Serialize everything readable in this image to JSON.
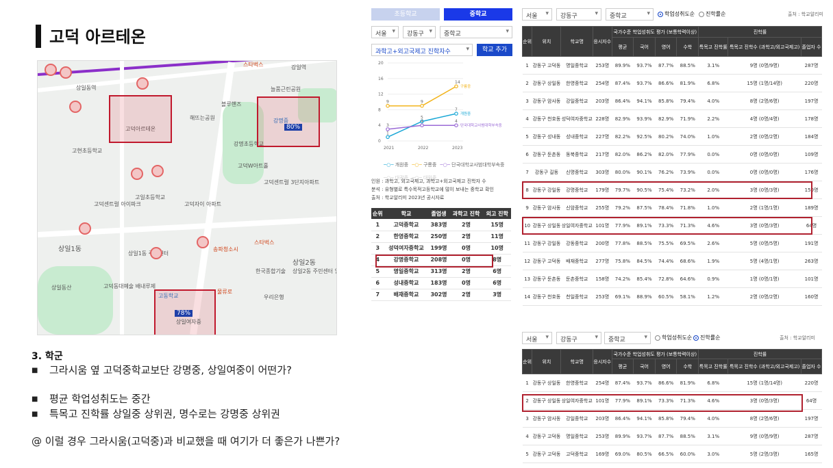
{
  "title": "고덕 아르테온",
  "map": {
    "labels": {
      "station1": "상일동역",
      "station2": "강일역",
      "starbucks1": "스타벅스",
      "park1": "늘품근린공원",
      "bluehands": "블루핸즈",
      "park2": "해뜨는공원",
      "gd_arteon": "고덕아르테온",
      "gangmyung_ms": "강명중",
      "gangmyung_es": "강명초등학교",
      "gangdong_ms": "강명초등학교",
      "wt": "고덕W아트홀",
      "gdref": "고덕센트럴\n3단지아파트",
      "gdschool1": "고현초등학교",
      "gdschool2": "고일초등학교",
      "gdcent": "고덕센트럴\n아이파크",
      "gdzai": "고덕자이\n아파트",
      "sangil1": "상일1동",
      "sangil1_center": "상일1동\n주민센터",
      "songpa": "송파청소시",
      "starbucks2": "스타벅스",
      "sangil2": "상일2동",
      "sangil2_center": "상일2동\n주민센터\n임시청사",
      "hankook": "한국종합기술",
      "gdcity": "고덕동대예술\n배내루제",
      "sangilsan": "상일동산",
      "gdhigh": "고동학교",
      "sangil_girls": "상일여자중",
      "woori": "우리은행",
      "nanum": "물류로",
      "pct_80": "80%",
      "pct_78": "78%"
    }
  },
  "section": {
    "heading": "3. 학군",
    "bullets": [
      "그라시움 옆 고덕중학교보단 강명중, 상일여중이 어떤가?",
      "평균 학업성취도는 중간",
      "특목고 진학률 상일중 상위권, 명수로는 강명중 상위권"
    ],
    "question": "@ 이럴 경우 그라시움(고덕중)과 비교했을 때 여기가 더 좋은가 나쁜가?"
  },
  "panel_mid": {
    "tabs": [
      "초등학교",
      "중학교"
    ],
    "filters": [
      "서울",
      "강동구",
      "중학교"
    ],
    "category": "과학고+외고국제고 진학자수",
    "add_button": "학교 추가",
    "legend": [
      "개원중",
      "구룡중",
      "단국대학교사범대학부속중",
      "대광중",
      "대원중"
    ],
    "notes": [
      "인원 : 과학고, 외고국제고, 과학고+외고국제고 진학자 수",
      "분석 : 유형별로 특수목적고등학교에 많이 보내는 중학교 확인",
      "출처 : 학교알리미 2023년 공시자료"
    ],
    "table": {
      "headers": [
        "순위",
        "학교",
        "졸업생",
        "과학고 진학",
        "외고 진학"
      ],
      "rows": [
        [
          "1",
          "고덕중학교",
          "383명",
          "2명",
          "15명"
        ],
        [
          "2",
          "한영중학교",
          "250명",
          "2명",
          "11명"
        ],
        [
          "3",
          "성덕여자중학교",
          "199명",
          "0명",
          "10명"
        ],
        [
          "4",
          "강명중학교",
          "208명",
          "0명",
          "8명"
        ],
        [
          "5",
          "명일중학교",
          "313명",
          "2명",
          "6명"
        ],
        [
          "6",
          "성내중학교",
          "183명",
          "0명",
          "6명"
        ],
        [
          "7",
          "배재중학교",
          "302명",
          "2명",
          "3명"
        ]
      ]
    }
  },
  "chart_data": {
    "type": "line",
    "x": [
      "2021",
      "2022",
      "2023"
    ],
    "ylim": [
      0,
      20
    ],
    "yticks": [
      0,
      4,
      8,
      12,
      16,
      20
    ],
    "series": [
      {
        "name": "개원중",
        "values": [
          1,
          5,
          7
        ],
        "color": "#19a7d6"
      },
      {
        "name": "구룡중",
        "values": [
          9,
          9,
          14
        ],
        "color": "#f2b41c"
      },
      {
        "name": "단국대학교사범대학부속중",
        "values": [
          3,
          4,
          4
        ],
        "color": "#9a6ad6"
      }
    ],
    "point_labels": [
      [
        "1",
        "5",
        "7"
      ],
      [
        "9",
        "9",
        "14"
      ],
      [
        "3",
        "4",
        "4"
      ]
    ],
    "end_labels": [
      "개원중",
      "구룡중",
      "단국대학교사범대학부속중"
    ]
  },
  "panel_right": {
    "filters": [
      "서울",
      "강동구",
      "중학교"
    ],
    "radio_a": "학업성취도순",
    "radio_b": "진학률순",
    "source": "출처 : 학교알리미",
    "headers_top": [
      "순위",
      "위치",
      "학교명",
      "응시자수",
      "국가수준 학업성취도 평가 (보통학력이상)",
      "진학률"
    ],
    "headers_sub": [
      "평균",
      "국어",
      "영어",
      "수학",
      "특목고 진학률",
      "특목고 진학수 (과학고/외고국제고)",
      "졸업자 수"
    ],
    "rows": [
      [
        "1",
        "강동구 고덕동",
        "명일중학교",
        "253명",
        "89.9%",
        "93.7%",
        "87.7%",
        "88.5%",
        "3.1%",
        "9명 (0명/9명)",
        "287명"
      ],
      [
        "2",
        "강동구 상일동",
        "한영중학교",
        "254명",
        "87.4%",
        "93.7%",
        "86.6%",
        "81.9%",
        "6.8%",
        "15명 (1명/14명)",
        "220명"
      ],
      [
        "3",
        "강동구 암사동",
        "강일중학교",
        "203명",
        "86.4%",
        "94.1%",
        "85.8%",
        "79.4%",
        "4.0%",
        "8명 (2명/6명)",
        "197명"
      ],
      [
        "4",
        "강동구 천호동",
        "성덕여자중학교",
        "228명",
        "82.9%",
        "93.9%",
        "82.9%",
        "71.9%",
        "2.2%",
        "4명 (0명/4명)",
        "178명"
      ],
      [
        "5",
        "강동구 성내동",
        "성내중학교",
        "227명",
        "82.2%",
        "92.5%",
        "80.2%",
        "74.0%",
        "1.0%",
        "2명 (0명/2명)",
        "184명"
      ],
      [
        "6",
        "강동구 둔촌동",
        "동북중학교",
        "217명",
        "82.0%",
        "86.2%",
        "82.0%",
        "77.9%",
        "0.0%",
        "0명 (0명/0명)",
        "109명"
      ],
      [
        "7",
        "강동구 길동",
        "신명중학교",
        "303명",
        "80.0%",
        "90.1%",
        "76.2%",
        "73.9%",
        "0.0%",
        "0명 (0명/0명)",
        "176명"
      ],
      [
        "8",
        "강동구 강일동",
        "강명중학교",
        "179명",
        "79.7%",
        "90.5%",
        "75.4%",
        "73.2%",
        "2.0%",
        "3명 (0명/3명)",
        "150명"
      ],
      [
        "9",
        "강동구 암사동",
        "신암중학교",
        "255명",
        "79.2%",
        "87.5%",
        "78.4%",
        "71.8%",
        "1.0%",
        "2명 (1명/1명)",
        "189명"
      ],
      [
        "10",
        "강동구 상일동",
        "상일여자중학교",
        "101명",
        "77.9%",
        "89.1%",
        "73.3%",
        "71.3%",
        "4.6%",
        "3명 (0명/3명)",
        "64명"
      ],
      [
        "11",
        "강동구 강일동",
        "강동중학교",
        "200명",
        "77.8%",
        "88.5%",
        "75.5%",
        "69.5%",
        "2.6%",
        "5명 (0명/5명)",
        "191명"
      ],
      [
        "12",
        "강동구 고덕동",
        "배재중학교",
        "277명",
        "75.8%",
        "84.5%",
        "74.4%",
        "68.6%",
        "1.9%",
        "5명 (4명/1명)",
        "263명"
      ],
      [
        "13",
        "강동구 둔촌동",
        "둔촌중학교",
        "158명",
        "74.2%",
        "85.4%",
        "72.8%",
        "64.6%",
        "0.9%",
        "1명 (0명/1명)",
        "101명"
      ],
      [
        "14",
        "강동구 천호동",
        "천일중학교",
        "253명",
        "69.1%",
        "88.9%",
        "60.5%",
        "58.1%",
        "1.2%",
        "2명 (0명/2명)",
        "160명"
      ]
    ]
  },
  "panel_bottom": {
    "filters": [
      "서울",
      "강동구",
      "중학교"
    ],
    "radio_a": "학업성취도순",
    "radio_b": "진학률순",
    "source": "출처 : 학교알리미",
    "rows": [
      [
        "1",
        "강동구 상일동",
        "한영중학교",
        "254명",
        "87.4%",
        "93.7%",
        "86.6%",
        "81.9%",
        "6.8%",
        "15명 (1명/14명)",
        "220명"
      ],
      [
        "2",
        "강동구 상일동",
        "상일여자중학교",
        "101명",
        "77.9%",
        "89.1%",
        "73.3%",
        "71.3%",
        "4.6%",
        "3명 (0명/3명)",
        "64명"
      ],
      [
        "3",
        "강동구 암사동",
        "강일중학교",
        "203명",
        "86.4%",
        "94.1%",
        "85.8%",
        "79.4%",
        "4.0%",
        "8명 (2명/6명)",
        "197명"
      ],
      [
        "4",
        "강동구 고덕동",
        "명일중학교",
        "253명",
        "89.9%",
        "93.7%",
        "87.7%",
        "88.5%",
        "3.1%",
        "9명 (0명/9명)",
        "287명"
      ],
      [
        "5",
        "강동구 고덕동",
        "고덕중학교",
        "169명",
        "69.0%",
        "80.5%",
        "66.5%",
        "60.0%",
        "3.0%",
        "5명 (2명/3명)",
        "165명"
      ]
    ]
  }
}
